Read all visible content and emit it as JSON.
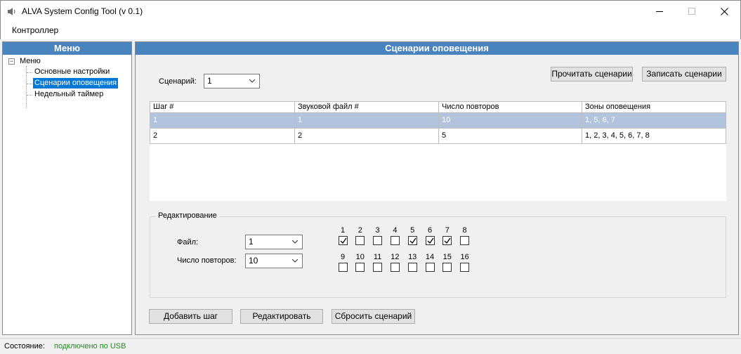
{
  "window": {
    "title": "ALVA System Config Tool (v 0.1)",
    "minimize": "—",
    "maximize": "☐",
    "close": "✕"
  },
  "menubar": {
    "items": [
      "Контроллер"
    ]
  },
  "sidebar": {
    "header": "Меню",
    "root": "Меню",
    "toggle": "−",
    "items": [
      {
        "label": "Основные настройки",
        "selected": false
      },
      {
        "label": "Сценарии оповещения",
        "selected": true
      },
      {
        "label": "Недельный таймер",
        "selected": false
      }
    ]
  },
  "main": {
    "header": "Сценарии оповещения",
    "scenario_label": "Сценарий:",
    "scenario_value": "1",
    "read_button": "Прочитать сценарии",
    "write_button": "Записать сценарии",
    "table": {
      "columns": [
        "Шаг #",
        "Звуковой файл #",
        "Число повторов",
        "Зоны оповещения"
      ],
      "rows": [
        [
          "1",
          "1",
          "10",
          "1, 5, 6, 7"
        ],
        [
          "2",
          "2",
          "5",
          "1, 2, 3, 4, 5, 6, 7, 8"
        ]
      ],
      "selected_row": 0
    },
    "edit": {
      "title": "Редактирование",
      "file_label": "Файл:",
      "file_value": "1",
      "repeats_label": "Число повторов:",
      "repeats_value": "10",
      "zones": [
        {
          "num": "1",
          "checked": true
        },
        {
          "num": "2",
          "checked": false
        },
        {
          "num": "3",
          "checked": false
        },
        {
          "num": "4",
          "checked": false
        },
        {
          "num": "5",
          "checked": true
        },
        {
          "num": "6",
          "checked": true
        },
        {
          "num": "7",
          "checked": true
        },
        {
          "num": "8",
          "checked": false
        },
        {
          "num": "9",
          "checked": false
        },
        {
          "num": "10",
          "checked": false
        },
        {
          "num": "11",
          "checked": false
        },
        {
          "num": "12",
          "checked": false
        },
        {
          "num": "13",
          "checked": false
        },
        {
          "num": "14",
          "checked": false
        },
        {
          "num": "15",
          "checked": false
        },
        {
          "num": "16",
          "checked": false
        }
      ]
    },
    "add_button": "Добавить шаг",
    "edit_button": "Редактировать",
    "reset_button": "Сбросить сценарий"
  },
  "status": {
    "label": "Состояние:",
    "value": "подключено по USB",
    "value_color": "#1e8b1e"
  },
  "colors": {
    "header_blue": "#4a84bf",
    "selection_blue": "#0078d7",
    "row_selected": "#b2c4dd"
  }
}
